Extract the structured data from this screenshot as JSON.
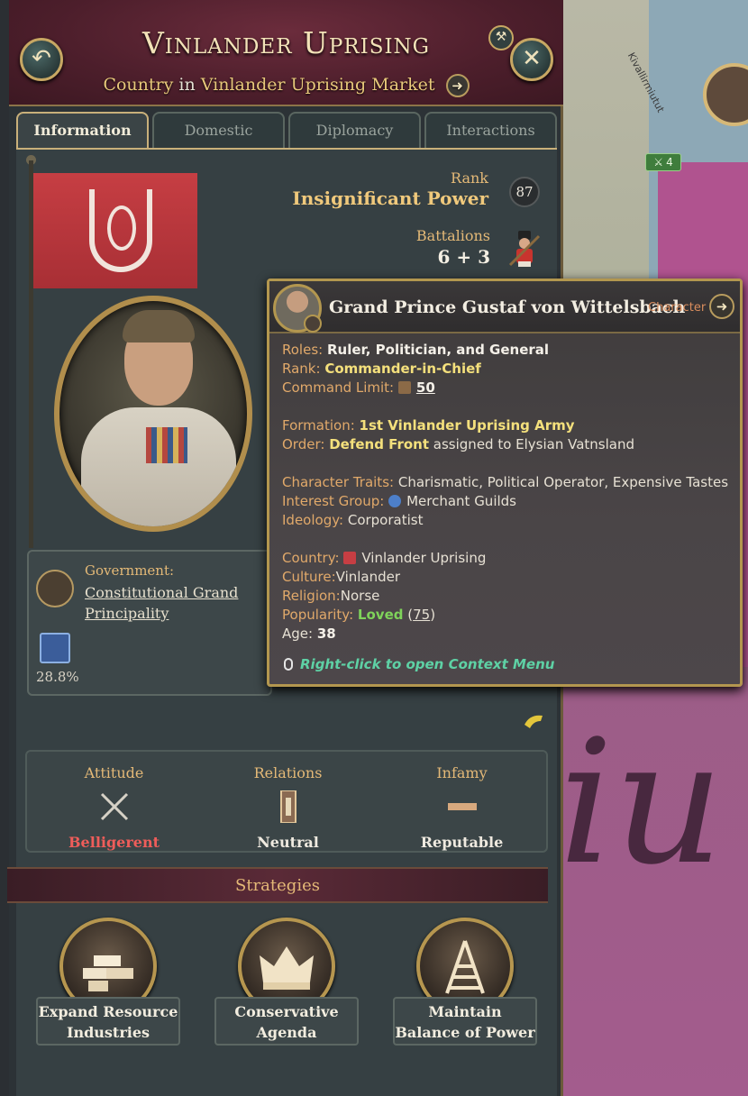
{
  "header": {
    "title": "Vinlander Uprising",
    "subtitle_kind": "Country",
    "subtitle_in": "in",
    "subtitle_market": "Vinlander Uprising Market",
    "back_icon": "back-arrow-icon",
    "close_icon": "close-icon",
    "pin_icon": "pin-icon"
  },
  "tabs": [
    {
      "label": "Information",
      "active": true
    },
    {
      "label": "Domestic",
      "active": false
    },
    {
      "label": "Diplomacy",
      "active": false
    },
    {
      "label": "Interactions",
      "active": false
    }
  ],
  "rank": {
    "label": "Rank",
    "value": "Insignificant Power",
    "number": "87"
  },
  "battalions": {
    "label": "Battalions",
    "value": "6 + 3"
  },
  "government": {
    "label": "Government:",
    "value": "Constitutional Grand Principality",
    "legitimacy": "28.8%"
  },
  "attitude": [
    {
      "label": "Attitude",
      "value": "Belligerent",
      "icon": "crossed-swords-icon"
    },
    {
      "label": "Relations",
      "value": "Neutral",
      "icon": "relations-bar-icon"
    },
    {
      "label": "Infamy",
      "value": "Reputable",
      "icon": "infamy-bar-icon"
    }
  ],
  "strategies": {
    "title": "Strategies",
    "items": [
      {
        "label": "Expand Resource Industries",
        "icon": "bricks-icon"
      },
      {
        "label": "Conservative Agenda",
        "icon": "crown-icon"
      },
      {
        "label": "Maintain Balance of Power",
        "icon": "house-of-cards-icon"
      }
    ]
  },
  "tooltip": {
    "name": "Grand Prince Gustaf von Wittelsbach",
    "kind": "Character",
    "roles_label": "Roles:",
    "roles": "Ruler, Politician, and General",
    "rank_label": "Rank:",
    "rank": "Commander-in-Chief",
    "command_limit_label": "Command Limit:",
    "command_limit": "50",
    "formation_label": "Formation:",
    "formation": "1st Vinlander Uprising Army",
    "order_label": "Order:",
    "order": "Defend Front",
    "order_suffix": "assigned to Elysian Vatnsland",
    "traits_label": "Character Traits:",
    "traits": "Charismatic, Political Operator, Expensive Tastes",
    "interest_label": "Interest Group:",
    "interest": "Merchant Guilds",
    "ideology_label": "Ideology:",
    "ideology": "Corporatist",
    "country_label": "Country:",
    "country": "Vinlander Uprising",
    "culture_label": "Culture:",
    "culture": "Vinlander",
    "religion_label": "Religion:",
    "religion": "Norse",
    "popularity_label": "Popularity:",
    "popularity": "Loved",
    "popularity_value": "75",
    "age_label": "Age:",
    "age": "38",
    "footer": "Right-click to open Context Menu"
  },
  "map": {
    "region_label": "Kivallirmiutut",
    "army_count": "4",
    "region_letters": "iu"
  },
  "colors": {
    "accent_gold": "#e4b977",
    "header_red": "#4c1e2b",
    "belligerent": "#ef5d5a",
    "loved": "#7fd35a",
    "context_hint": "#5ed1a5"
  }
}
